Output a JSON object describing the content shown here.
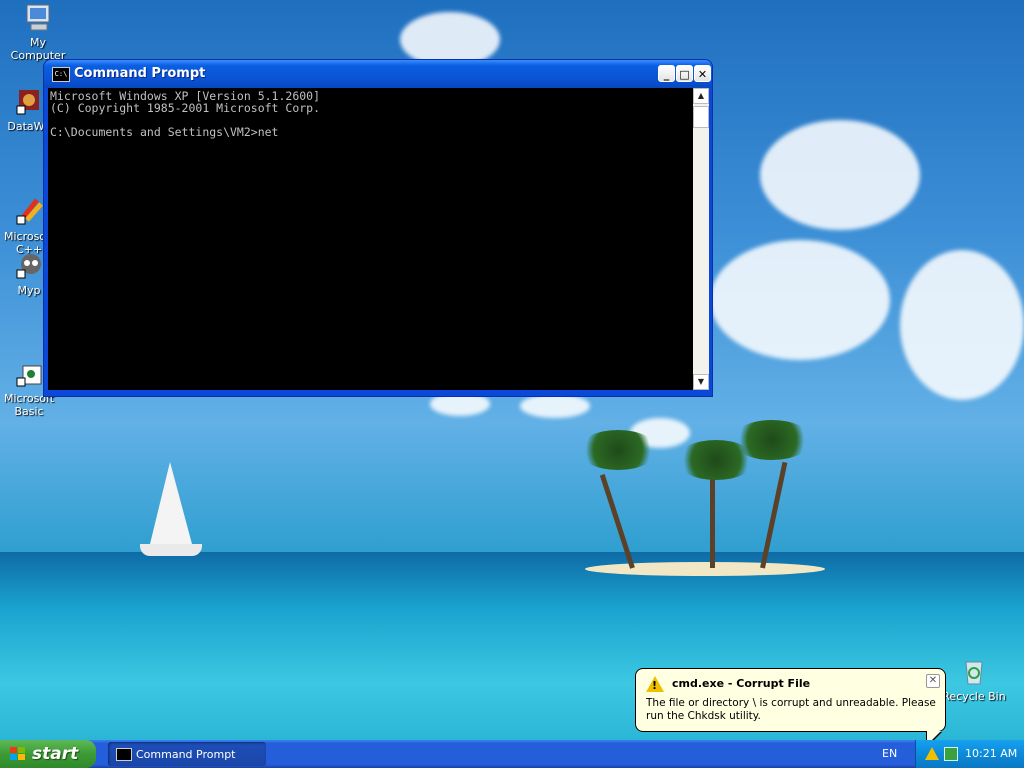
{
  "desktop": {
    "icons": [
      {
        "label": "My Computer"
      },
      {
        "label": "DataWa"
      },
      {
        "label": "Microsoft\nC++"
      },
      {
        "label": "Myp"
      },
      {
        "label": "Microsoft\nBasic"
      },
      {
        "label": "Recycle Bin"
      }
    ]
  },
  "window": {
    "title": "Command Prompt",
    "icon_text": "C:\\",
    "buttons": {
      "minimize": "_",
      "maximize": "□",
      "close": "✕"
    },
    "console_text": "Microsoft Windows XP [Version 5.1.2600]\n(C) Copyright 1985-2001 Microsoft Corp.\n\nC:\\Documents and Settings\\VM2>net"
  },
  "balloon": {
    "title": "cmd.exe - Corrupt File",
    "message": "The file or directory \\ is corrupt and unreadable. Please run the Chkdsk utility.",
    "close": "✕"
  },
  "taskbar": {
    "start_label": "start",
    "task_label": "Command Prompt",
    "language": "EN",
    "clock": "10:21 AM"
  },
  "colors": {
    "titlebar": "#0a55d8",
    "taskbar": "#245edb",
    "start": "#3c9b34",
    "balloon_bg": "#ffffe1"
  }
}
